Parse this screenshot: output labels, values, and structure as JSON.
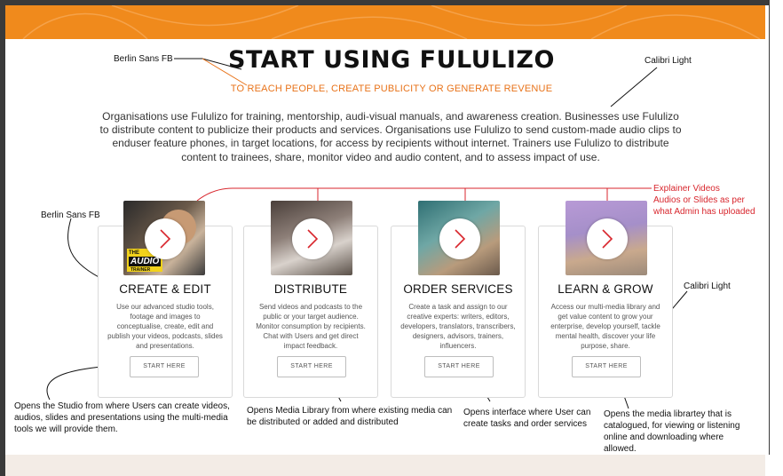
{
  "page": {
    "title": "START USING FULULIZO",
    "subtitle": "TO REACH PEOPLE, CREATE PUBLICITY OR GENERATE REVENUE",
    "intro": "Organisations use Fululizo for training, mentorship, audi-visual manuals, and awareness creation. Businesses use Fululizo to distribute content to publicize their products and services. Organisations use Fululizo to send custom-made audio clips to enduser feature phones, in target locations, for access by recipients without internet. Trainers use Fululizo to distribute content to trainees, share, monitor video and audio content, and to assess impact of use."
  },
  "annotations": {
    "title_font": "Berlin Sans FB",
    "intro_font": "Calibri Light",
    "card_title_font": "Berlin Sans FB",
    "card_desc_font": "Calibri Light",
    "explainer": [
      "Explainer Videos",
      "Audios or Slides as per",
      "what Admin has uploaded"
    ],
    "create_note": "Opens the Studio from where Users can create videos, audios, slides and presentations using the multi-media tools we will provide them.",
    "distribute_note": "Opens Media Library from where existing media can be distributed or added and distributed",
    "order_note": "Opens interface where User can create tasks and order services",
    "learn_note": "Opens the media librartey that is catalogued, for viewing or listening online and downloading where allowed."
  },
  "cards": [
    {
      "title": "CREATE & EDIT",
      "description": "Use our advanced studio tools, footage and images to conceptualise, create, edit and publish your videos, podcasts, slides and presentations.",
      "button": "START HERE",
      "thumb_label": [
        "THE",
        "AUDIO",
        "TRAINER"
      ],
      "icon": "play-chevron-icon"
    },
    {
      "title": "DISTRIBUTE",
      "description": "Send videos and podcasts to the public or your target audience. Monitor consumption by recipients. Chat with Users and get direct impact feedback.",
      "button": "START HERE",
      "icon": "play-chevron-icon"
    },
    {
      "title": "ORDER SERVICES",
      "description": "Create a task and assign to our creative experts: writers, editors, developers, translators, transcribers, designers, advisors, trainers, influencers.",
      "button": "START HERE",
      "icon": "play-chevron-icon"
    },
    {
      "title": "LEARN & GROW",
      "description": "Access our multi-media library and get value content to grow your enterprise, develop yourself, tackle mental health, discover your life purpose, share.",
      "button": "START HERE",
      "icon": "play-chevron-icon"
    }
  ],
  "colors": {
    "banner": "#f08a1c",
    "accent": "#e8731a",
    "annotation_red": "#d8262d"
  }
}
